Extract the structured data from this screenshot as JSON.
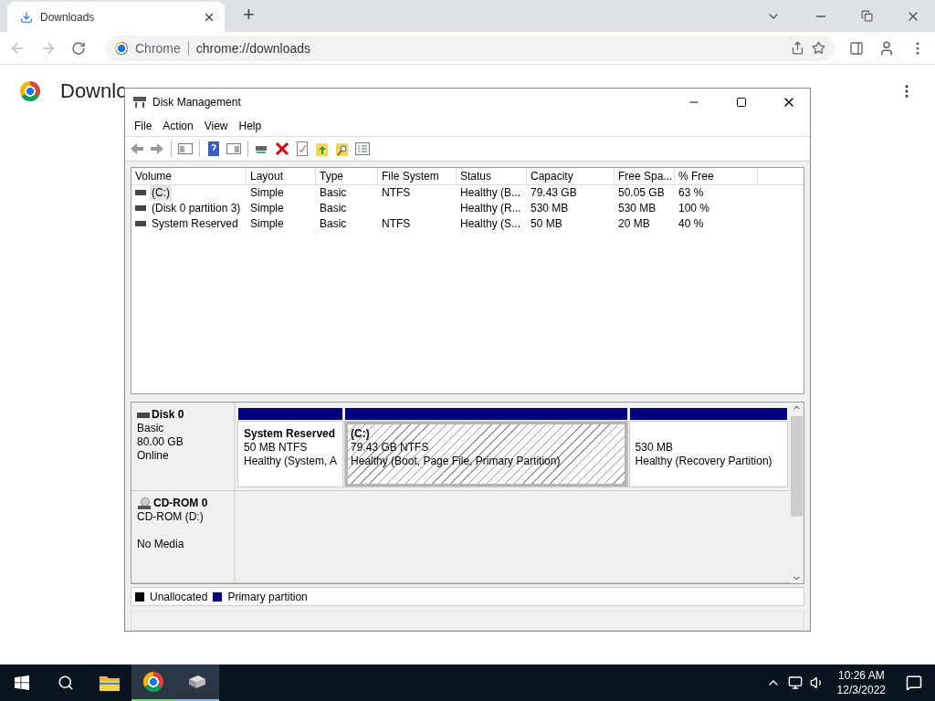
{
  "browser": {
    "tab": {
      "title": "Downloads"
    },
    "new_tab": "+",
    "omnibox": {
      "chip": "Chrome",
      "url": "chrome://downloads"
    },
    "page_title": "Downlo"
  },
  "disk_management": {
    "title": "Disk Management",
    "menu": [
      "File",
      "Action",
      "View",
      "Help"
    ],
    "columns": [
      "Volume",
      "Layout",
      "Type",
      "File System",
      "Status",
      "Capacity",
      "Free Spa...",
      "% Free"
    ],
    "rows": [
      {
        "selected": true,
        "cells": [
          "(C:)",
          "Simple",
          "Basic",
          "NTFS",
          "Healthy (B...",
          "79.43 GB",
          "50.05 GB",
          "63 %"
        ]
      },
      {
        "selected": false,
        "cells": [
          "(Disk 0 partition 3)",
          "Simple",
          "Basic",
          "",
          "Healthy (R...",
          "530 MB",
          "530 MB",
          "100 %"
        ]
      },
      {
        "selected": false,
        "cells": [
          "System Reserved",
          "Simple",
          "Basic",
          "NTFS",
          "Healthy (S...",
          "50 MB",
          "20 MB",
          "40 %"
        ]
      }
    ],
    "disks": [
      {
        "kind": "disk",
        "name": "Disk 0",
        "type": "Basic",
        "size": "80.00 GB",
        "status": "Online",
        "partitions": [
          {
            "title": "System Reserved",
            "detail": "50 MB NTFS",
            "health": "Healthy (System, A",
            "selected": false
          },
          {
            "title": "(C:)",
            "detail": "79.43 GB NTFS",
            "health": "Healthy (Boot, Page File, Primary Partition)",
            "selected": true
          },
          {
            "detail": "530 MB",
            "health": "Healthy (Recovery Partition)",
            "selected": false
          }
        ]
      },
      {
        "kind": "cdrom",
        "name": "CD-ROM 0",
        "type": "CD-ROM (D:)",
        "status": "No Media"
      }
    ],
    "legend": [
      {
        "label": "Unallocated",
        "color": "#000000"
      },
      {
        "label": "Primary partition",
        "color": "#000080"
      }
    ]
  },
  "taskbar": {
    "time": "10:26 AM",
    "date": "12/3/2022"
  }
}
